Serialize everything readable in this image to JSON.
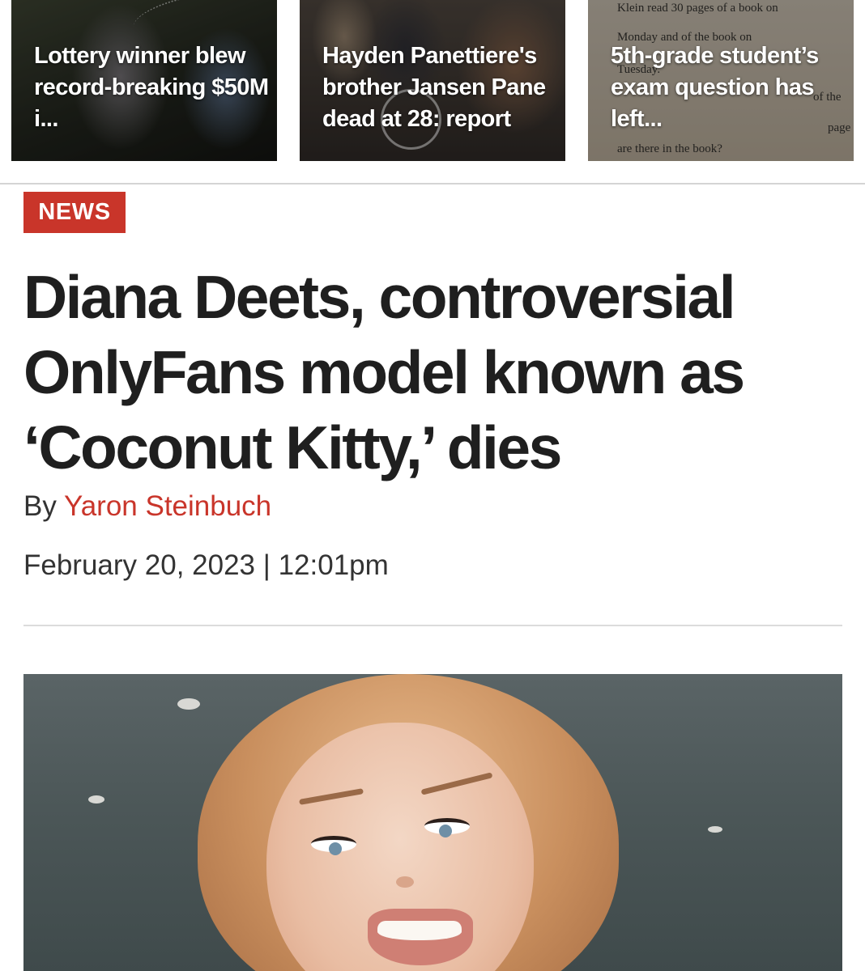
{
  "related_stories": [
    {
      "title": "Lottery winner blew record-breaking $50M i...",
      "image_icon": "lottery-winner-photo"
    },
    {
      "title": "Hayden Panettiere's brother Jansen Pane dead at 28: report",
      "image_icon": "jansen-panettiere-photo"
    },
    {
      "title": "5th-grade student’s exam question has left...",
      "image_icon": "exam-worksheet-photo",
      "worksheet_lines": [
        "Klein read 30 pages of a book on",
        "Monday and    of the book on",
        "Tuesday.",
        "of the",
        "page",
        "are there in the book?"
      ]
    }
  ],
  "article": {
    "section": "NEWS",
    "headline": "Diana Deets, controversial OnlyFans model known as ‘Coconut Kitty,’ dies",
    "byline_prefix": "By",
    "author": "Yaron Steinbuch",
    "date": "February 20, 2023",
    "separator": "|",
    "time": "12:01pm",
    "hero_image_icon": "diana-deets-portrait-photo"
  },
  "colors": {
    "accent_red": "#c9352a",
    "body_text": "#1f1f1f",
    "meta_text": "#333333",
    "rule": "#d4d4d4"
  }
}
